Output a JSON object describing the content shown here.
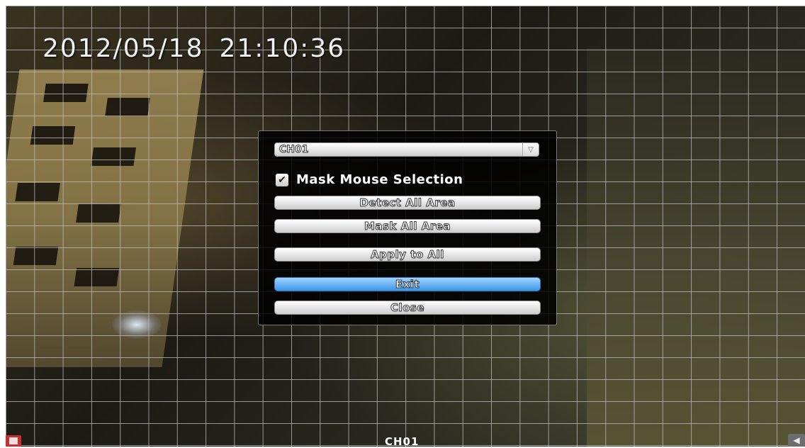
{
  "overlay": {
    "date": "2012/05/18",
    "time": "21:10:36",
    "channel_label": "CH01"
  },
  "dialog": {
    "channel_select": {
      "value": "CH01"
    },
    "mask_mouse_selection": {
      "label": "Mask Mouse Selection",
      "checked": true
    },
    "buttons": {
      "detect_all": "Detect All Area",
      "mask_all": "Mask All Area",
      "apply_all": "Apply to All",
      "exit": "Exit",
      "close": "Close"
    },
    "active_button_color": "#3b95e6"
  },
  "icons": {
    "record": "film-icon",
    "audio": "speaker-icon"
  }
}
